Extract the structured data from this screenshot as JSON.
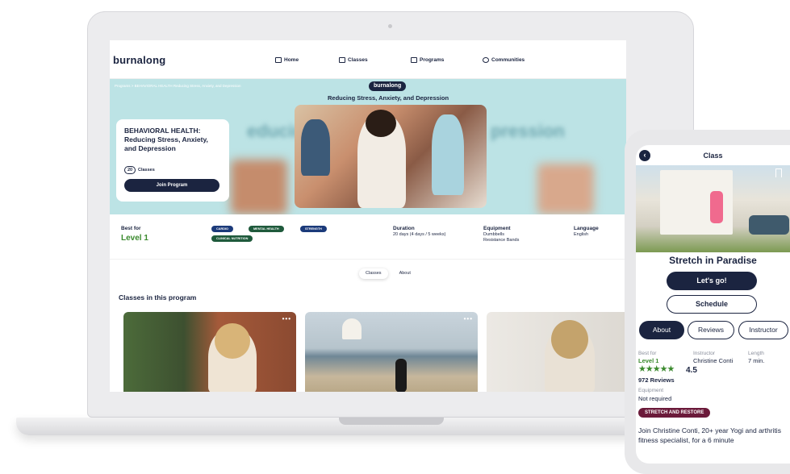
{
  "nav": {
    "logo": "burnalong",
    "items": [
      "Home",
      "Classes",
      "Programs",
      "Communities"
    ]
  },
  "hero": {
    "breadcrumb": "Programs  >  BEHAVIORAL HEALTH Reducing Stress, Anxiety, and Depression",
    "badge": "burnalong",
    "subtitle": "Reducing Stress, Anxiety, and Depression",
    "blur_left": "educing",
    "blur_right": "pression",
    "card_title": "BEHAVIORAL HEALTH: Reducing Stress, Anxiety, and Depression",
    "class_count": "20",
    "class_count_label": "Classes",
    "join_label": "Join Program"
  },
  "info": {
    "best_for_label": "Best for",
    "best_for_value": "Level 1",
    "tags": [
      {
        "label": "CARDIO",
        "color": "#1b3a7a"
      },
      {
        "label": "MENTAL HEALTH",
        "color": "#1f5a3c"
      },
      {
        "label": "STRENGTH",
        "color": "#1b3a7a"
      },
      {
        "label": "CLINICAL NUTRITION",
        "color": "#1f5a3c"
      }
    ],
    "duration_label": "Duration",
    "duration_value": "20 days (4 days / 5 weeks)",
    "equipment_label": "Equipment",
    "equipment_value1": "Dumbbells",
    "equipment_value2": "Resistance Bands",
    "language_label": "Language",
    "language_value": "English"
  },
  "tabs": [
    "Classes",
    "About"
  ],
  "section_title": "Classes in this program",
  "phone": {
    "title": "Class",
    "class_name": "Stretch in Paradise",
    "letsgo": "Let's go!",
    "schedule": "Schedule",
    "tabs": [
      "About",
      "Reviews",
      "Instructor"
    ],
    "best_for_label": "Best for",
    "best_for_value": "Level 1",
    "instructor_label": "Instructor",
    "instructor_value": "Christine Conti",
    "length_label": "Length",
    "length_value": "7 min.",
    "stars": "★★★★★",
    "rating": "4.5",
    "reviews": "972 Reviews",
    "equipment_label": "Equipment",
    "equipment_value": "Not required",
    "tag": "STRETCH AND RESTORE",
    "description": "Join Christine Conti, 20+ year Yogi and arthritis fitness specialist, for a 6 minute"
  },
  "colors": {
    "navy": "#1b2440",
    "hero_bg": "#bce3e5",
    "level_green": "#3b8a2e",
    "tag_maroon": "#6b1a3a"
  }
}
